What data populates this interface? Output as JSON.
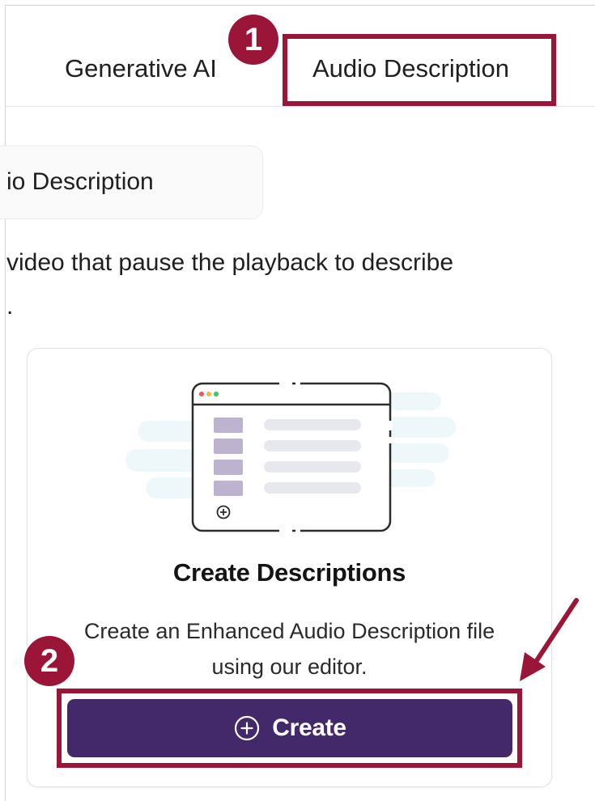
{
  "tabs": [
    {
      "label": "Generative AI"
    },
    {
      "label": "Audio Description"
    }
  ],
  "section": {
    "heading": "io Description",
    "description_line1": "video that pause the playback to describe",
    "description_line2": "."
  },
  "card": {
    "title": "Create Descriptions",
    "description_line1": "Create an Enhanced Audio Description file",
    "description_line2": "using our editor.",
    "button_label": "Create"
  },
  "annotations": {
    "step1": "1",
    "step2": "2"
  },
  "colors": {
    "annotation": "#9b1538",
    "button": "#43296a",
    "illustration_list": "#bdb3cf",
    "illustration_bars": "#e7e8ee",
    "illustration_bg": "#eef8fb"
  },
  "icons": {
    "create": "plus-circle-icon",
    "illustration": "editor-window-illustration"
  }
}
